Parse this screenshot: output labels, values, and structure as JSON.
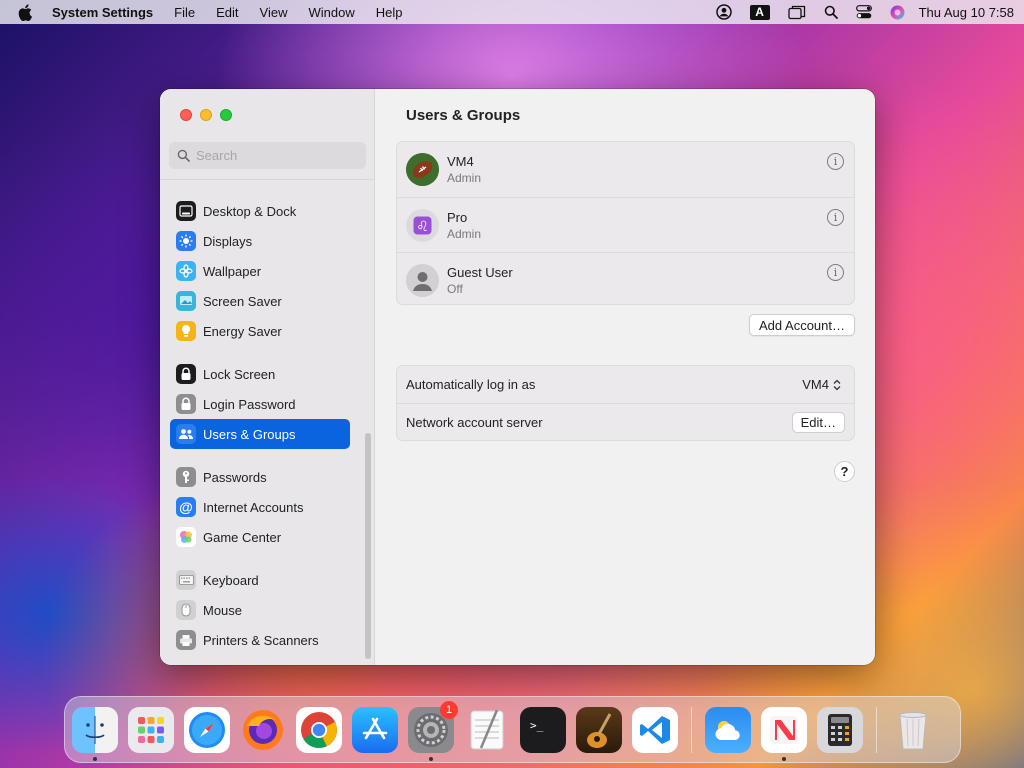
{
  "menubar": {
    "app_name": "System Settings",
    "menus": [
      "File",
      "Edit",
      "View",
      "Window",
      "Help"
    ],
    "input_indicator": "A",
    "clock": "Thu Aug 10  7:58"
  },
  "search": {
    "placeholder": "Search",
    "value": ""
  },
  "sidebar": {
    "items": [
      {
        "label": "Desktop & Dock",
        "icon": "desktop-dock-icon",
        "color": "#1c1c1e"
      },
      {
        "label": "Displays",
        "icon": "displays-icon",
        "color": "#2a7df0"
      },
      {
        "label": "Wallpaper",
        "icon": "wallpaper-icon",
        "color": "#3ab3f0"
      },
      {
        "label": "Screen Saver",
        "icon": "screen-saver-icon",
        "color": "#38b6d9"
      },
      {
        "label": "Energy Saver",
        "icon": "energy-saver-icon",
        "color": "#f6b31a"
      },
      {
        "label": "Lock Screen",
        "icon": "lock-screen-icon",
        "color": "#1c1c1e"
      },
      {
        "label": "Login Password",
        "icon": "login-password-icon",
        "color": "#8e8d90"
      },
      {
        "label": "Users & Groups",
        "icon": "users-groups-icon",
        "color": "#2a7df0"
      },
      {
        "label": "Passwords",
        "icon": "passwords-icon",
        "color": "#8e8d90"
      },
      {
        "label": "Internet Accounts",
        "icon": "internet-accounts-icon",
        "color": "#2a7df0"
      },
      {
        "label": "Game Center",
        "icon": "game-center-icon",
        "color": "#ffffff"
      },
      {
        "label": "Keyboard",
        "icon": "keyboard-icon",
        "color": "#d0cfd2"
      },
      {
        "label": "Mouse",
        "icon": "mouse-icon",
        "color": "#d0cfd2"
      },
      {
        "label": "Printers & Scanners",
        "icon": "printers-scanners-icon",
        "color": "#8e8d90"
      }
    ],
    "active_index": 7
  },
  "content": {
    "title": "Users & Groups",
    "users": [
      {
        "name": "VM4",
        "role": "Admin",
        "avatar": "football-avatar-icon"
      },
      {
        "name": "Pro",
        "role": "Admin",
        "avatar": "leo-avatar-icon"
      },
      {
        "name": "Guest User",
        "role": "Off",
        "avatar": "guest-avatar-icon"
      }
    ],
    "add_account_label": "Add Account…",
    "auto_login_label": "Automatically log in as",
    "auto_login_value": "VM4",
    "network_server_label": "Network account server",
    "edit_label": "Edit…",
    "help_label": "?"
  },
  "dock": {
    "apps": [
      "Finder",
      "Launchpad",
      "Safari",
      "Firefox",
      "Chrome",
      "App Store",
      "System Settings",
      "TextEdit",
      "Terminal",
      "GarageBand",
      "VS Code",
      "Weather",
      "News",
      "Calculator",
      "Trash"
    ],
    "system_settings_badge": "1"
  },
  "colors": {
    "accent": "#0a64e0",
    "close": "#fe5f57",
    "minimize": "#febc2e",
    "maximize": "#28c840"
  }
}
